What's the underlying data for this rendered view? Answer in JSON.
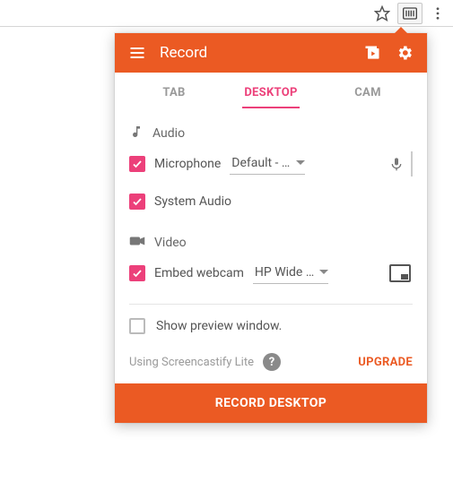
{
  "toolbar": {
    "star_title": "Bookmark",
    "ext_title": "Screencastify",
    "menu_title": "Menu"
  },
  "appbar": {
    "title": "Record"
  },
  "tabs": {
    "tab": "TAB",
    "desktop": "DESKTOP",
    "cam": "CAM"
  },
  "audio": {
    "header": "Audio",
    "microphone_label": "Microphone",
    "microphone_device": "Default - …",
    "system_audio_label": "System Audio"
  },
  "video": {
    "header": "Video",
    "embed_webcam_label": "Embed webcam",
    "webcam_device": "HP Wide …"
  },
  "preview": {
    "label": "Show preview window."
  },
  "footer": {
    "lite_text": "Using Screencastify Lite",
    "upgrade": "UPGRADE"
  },
  "record_button": "RECORD DESKTOP"
}
